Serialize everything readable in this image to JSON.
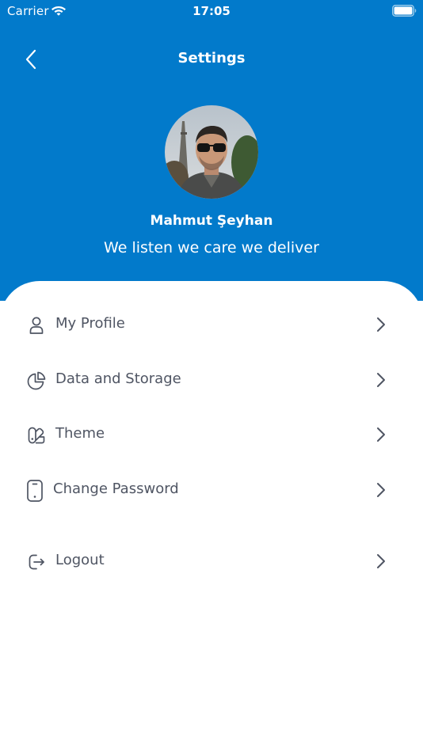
{
  "status_bar": {
    "carrier": "Carrier",
    "time": "17:05",
    "wifi_icon": "wifi-icon",
    "battery_icon": "battery-icon"
  },
  "nav": {
    "title": "Settings",
    "back_icon": "chevron-left-icon"
  },
  "profile": {
    "name": "Mahmut Şeyhan",
    "tagline": "We listen we care we deliver"
  },
  "menu": {
    "items": [
      {
        "label": "My Profile",
        "icon": "user-icon"
      },
      {
        "label": "Data and Storage",
        "icon": "pie-chart-icon"
      },
      {
        "label": "Theme",
        "icon": "palette-icon"
      },
      {
        "label": "Change Password",
        "icon": "phone-icon"
      },
      {
        "label": "Logout",
        "icon": "logout-icon"
      }
    ],
    "chevron_icon": "chevron-right-icon"
  },
  "colors": {
    "header_blue": "#027ACB",
    "text_gray": "#4F5563",
    "white": "#FFFFFF"
  }
}
